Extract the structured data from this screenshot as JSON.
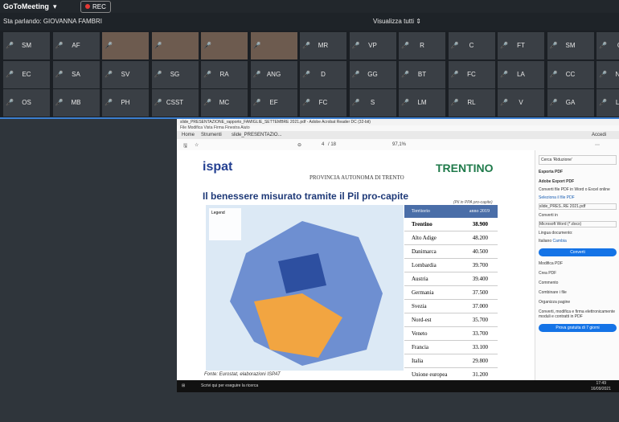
{
  "app": {
    "title": "GoToMeeting",
    "rec": "REC"
  },
  "speaking": "Sta parlando: GIOVANNA FAMBRI",
  "view_all": "Visualizza tutti",
  "participants_row1": [
    "SM",
    "AF",
    "",
    "",
    "",
    "",
    "MR",
    "VP",
    "R",
    "C",
    "FT",
    "SM",
    "G"
  ],
  "participants_row2": [
    "EC",
    "SA",
    "SV",
    "SG",
    "RA",
    "ANG",
    "D",
    "GG",
    "BT",
    "FC",
    "LA",
    "CC",
    "NA"
  ],
  "participants_row3": [
    "OS",
    "MB",
    "PH",
    "CSST",
    "MC",
    "EF",
    "FC",
    "S",
    "LM",
    "RL",
    "V",
    "GA",
    "LC"
  ],
  "acrobat": {
    "title": "slide_PRESENTAZIONE_rapporto_FAMIGLIE_SETTEMBRE 2021.pdf - Adobe Acrobat Reader DC (32-bit)",
    "menu": "File  Modifica  Vista  Firma  Finestra  Aiuto",
    "tabs": [
      "Home",
      "Strumenti",
      "slide_PRESENTAZIO..."
    ],
    "signin": "Accedi",
    "page": "4",
    "pages": "/ 18",
    "zoom": "97,1%",
    "panel": {
      "search": "Cerca 'Riduzione'",
      "export": "Esporta PDF",
      "adobe_export": "Adobe Export PDF",
      "convert_desc": "Converti file PDF in Word o Excel online",
      "select_file": "Seleziona il file PDF",
      "file": "slide_PRES..RE 2021.pdf",
      "convert_to": "Converti in",
      "format": "Microsoft Word (*.docx)",
      "doc_lang": "Lingua documento:",
      "lang": "Italiano",
      "change": "Cambia",
      "convert_btn": "Converti",
      "tools": [
        "Modifica PDF",
        "Crea PDF",
        "Commento",
        "Combinare i file",
        "Organizza pagine"
      ],
      "promo": "Converti, modifica e firma elettronicamente moduli e contratti in PDF",
      "trial": "Prova gratuita di 7 giorni"
    }
  },
  "slide": {
    "logo_left": "ispat",
    "province": "PROVINCIA AUTONOMA DI TRENTO",
    "logo_right": "TRENTINO",
    "title": "Il benessere misurato tramite il Pil pro-capite",
    "note": "(Pil in PPA pro-capite)",
    "legend": "Legend",
    "source": "Fonte: Eurostat, elaborazioni ISPAT",
    "table_head": {
      "name": "Territorio",
      "year": "anno 2019"
    },
    "table": [
      {
        "name": "Trentino",
        "value": "38.900"
      },
      {
        "name": "Alto Adige",
        "value": "48.200"
      },
      {
        "name": "Danimarca",
        "value": "40.500"
      },
      {
        "name": "Lombardia",
        "value": "39.700"
      },
      {
        "name": "Austria",
        "value": "39.400"
      },
      {
        "name": "Germania",
        "value": "37.500"
      },
      {
        "name": "Svezia",
        "value": "37.000"
      },
      {
        "name": "Nord-est",
        "value": "35.700"
      },
      {
        "name": "Veneto",
        "value": "33.700"
      },
      {
        "name": "Francia",
        "value": "33.100"
      },
      {
        "name": "Italia",
        "value": "29.800"
      },
      {
        "name": "Unione europea",
        "value": "31.200"
      }
    ]
  },
  "taskbar": {
    "search": "Scrivi qui per eseguire la ricerca",
    "time": "17:49",
    "date": "16/09/2021"
  }
}
